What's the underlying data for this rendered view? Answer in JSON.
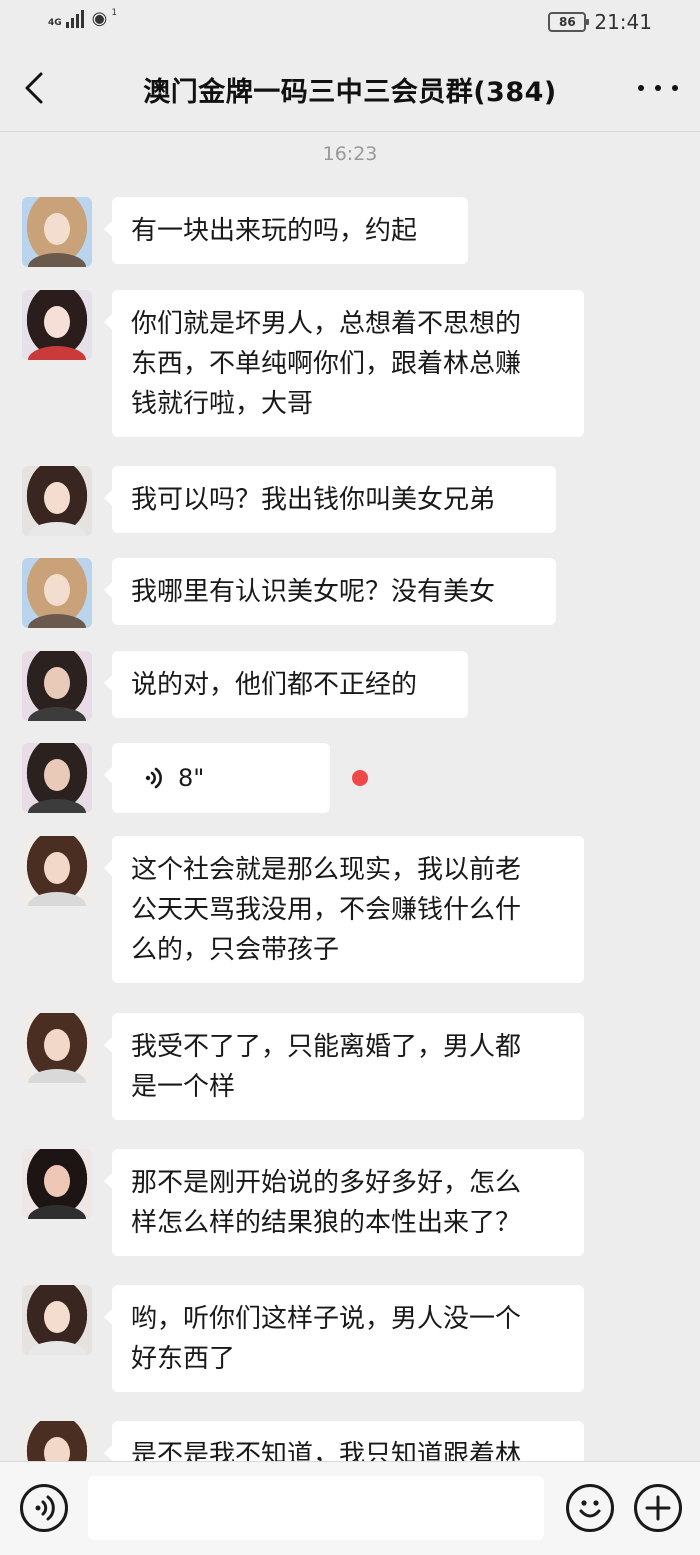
{
  "status_bar": {
    "network": "4G",
    "wifi_badge": "1",
    "battery": "86",
    "time": "21:41"
  },
  "header": {
    "title": "澳门金牌一码三中三会员群(384)"
  },
  "timestamp": "16:23",
  "messages": [
    {
      "type": "text",
      "avatar": "avatar-1",
      "lines": [
        "有一块出来玩的吗，约起"
      ]
    },
    {
      "type": "text",
      "avatar": "avatar-2",
      "lines": [
        "你们就是坏男人，总想着不思想的",
        "东西，不单纯啊你们，跟着林总赚",
        "钱就行啦，大哥"
      ]
    },
    {
      "type": "text",
      "avatar": "avatar-3",
      "lines": [
        "我可以吗？我出钱你叫美女兄弟"
      ]
    },
    {
      "type": "text",
      "avatar": "avatar-1",
      "lines": [
        "我哪里有认识美女呢？没有美女"
      ]
    },
    {
      "type": "text",
      "avatar": "avatar-4",
      "lines": [
        "说的对，他们都不正经的"
      ]
    },
    {
      "type": "voice",
      "avatar": "avatar-4",
      "duration": "8\""
    },
    {
      "type": "text",
      "avatar": "avatar-5",
      "lines": [
        "这个社会就是那么现实，我以前老",
        "公天天骂我没用，不会赚钱什么什",
        "么的，只会带孩子"
      ]
    },
    {
      "type": "text",
      "avatar": "avatar-5",
      "lines": [
        "我受不了了，只能离婚了，男人都",
        "是一个样"
      ]
    },
    {
      "type": "text",
      "avatar": "avatar-6",
      "lines": [
        "那不是刚开始说的多好多好，怎么",
        "样怎么样的结果狼的本性出来了？"
      ]
    },
    {
      "type": "text",
      "avatar": "avatar-3",
      "lines": [
        "哟，听你们这样子说，男人没一个",
        "好东西了"
      ]
    },
    {
      "type": "text",
      "avatar": "avatar-5",
      "lines": [
        "是不是我不知道，我只知道跟着林"
      ]
    }
  ],
  "icons": {
    "back": "back-arrow-icon",
    "more": "more-dots-icon",
    "voice_toggle": "voice-input-icon",
    "emoji": "emoji-icon",
    "plus": "plus-icon"
  },
  "colors": {
    "background": "#ededed",
    "bubble": "#ffffff",
    "unread": "#f04848"
  }
}
